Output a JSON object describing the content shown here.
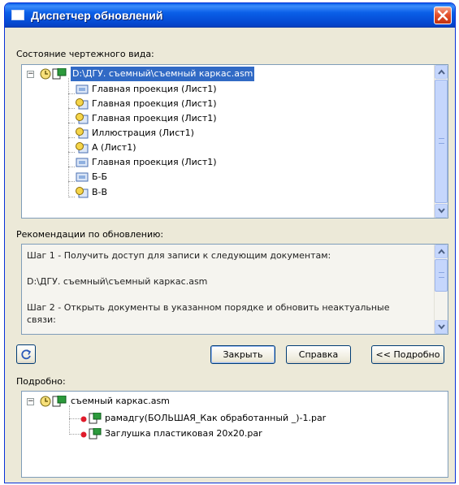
{
  "window": {
    "title": "Диспетчер обновлений"
  },
  "drawing_state": {
    "label": "Состояние чертежного вида:",
    "root": "D:\\ДГУ. съемный\\съемный каркас.asm",
    "items": [
      {
        "label": "Главная проекция (Лист1)",
        "icon": "view-icon"
      },
      {
        "label": "Главная проекция (Лист1)",
        "icon": "outdated-view-icon"
      },
      {
        "label": "Главная проекция (Лист1)",
        "icon": "outdated-view-icon"
      },
      {
        "label": "Иллюстрация (Лист1)",
        "icon": "outdated-view-icon"
      },
      {
        "label": "А (Лист1)",
        "icon": "outdated-view-icon"
      },
      {
        "label": "Главная проекция (Лист1)",
        "icon": "view-icon"
      },
      {
        "label": "Б-Б",
        "icon": "view-icon"
      },
      {
        "label": "В-В",
        "icon": "outdated-view-icon"
      }
    ]
  },
  "recommendations": {
    "label": "Рекомендации по обновлению:",
    "lines": [
      "Шаг 1 - Получить доступ для записи к следующим документам:",
      "D:\\ДГУ. съемный\\съемный каркас.asm",
      "Шаг 2 - Открыть документы в указанном порядке и обновить неактуальные",
      "связи:"
    ]
  },
  "buttons": {
    "close": "Закрыть",
    "help": "Справка",
    "details": "<< Подробно"
  },
  "details": {
    "label": "Подробно:",
    "root": "съемный каркас.asm",
    "items": [
      "рамадгу(БОЛЬШАЯ_Как обработанный _)-1.par",
      "Заглушка пластиковая 20х20.par"
    ]
  },
  "colors": {
    "titlebar": "#0a5fe8",
    "selection": "#316ac5",
    "window_bg": "#ece9d8",
    "close_button": "#e5512d"
  }
}
